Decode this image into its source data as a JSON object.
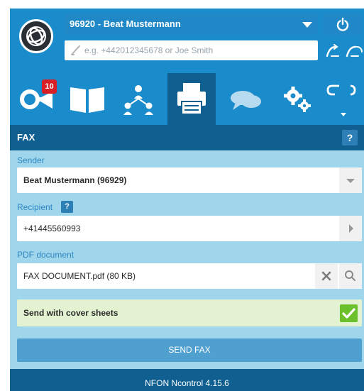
{
  "header": {
    "user_selector": "96920 - Beat Mustermann",
    "search_placeholder": "e.g. +442012345678 or Joe Smith",
    "logo_icon": "nfon-globe-logo",
    "power_icon": "power-icon",
    "call_icons": [
      "call-transfer-icon",
      "call-forward-icon"
    ]
  },
  "nav": {
    "items": [
      {
        "icon": "post-horn-icon",
        "badge": "10"
      },
      {
        "icon": "book-icon"
      },
      {
        "icon": "org-chart-icon"
      },
      {
        "icon": "fax-icon",
        "active": true
      },
      {
        "icon": "chat-bubbles-icon"
      },
      {
        "icon": "gears-icon"
      },
      {
        "icon": "call-redirect-icon"
      }
    ]
  },
  "panel": {
    "title": "FAX",
    "help_label": "?",
    "sender_label": "Sender",
    "sender_value": "Beat Mustermann (96929)",
    "recipient_label": "Recipient",
    "recipient_help": "?",
    "recipient_value": "+41445560993",
    "pdf_label": "PDF document",
    "pdf_value": "FAX DOCUMENT.pdf (80 KB)",
    "cover_label": "Send with cover sheets",
    "cover_checked": true,
    "send_label": "SEND FAX"
  },
  "footer": {
    "version": "NFON Ncontrol 4.15.6"
  },
  "colors": {
    "header_blue": "#1a8ccb",
    "dark_blue": "#0f5f91",
    "panel_bg": "#9fd6ec",
    "label_blue": "#2f86c2",
    "send_button": "#4f9fcf",
    "cover_bg": "#e3f3d1",
    "check_green": "#6cc02c",
    "badge_red": "#d81f26"
  }
}
